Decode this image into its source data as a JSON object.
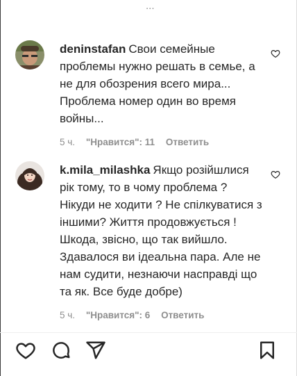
{
  "top_fragment": "...",
  "comments": [
    {
      "username": "deninstafan",
      "text": "Свои семейные проблемы нужно решать в семье, а не для обозрения всего мира... Проблема номер один во время войны...",
      "time": "5 ч.",
      "likes": "\"Нравится\": 11",
      "reply_label": "Ответить"
    },
    {
      "username": "k.mila_milashka",
      "text": "Якщо розійшлися рік тому, то в чому проблема ? Нікуди не ходити ? Не спілкуватися з іншими? Життя продовжується ! Шкода, звісно, що так вийшло. Здавалося ви ідеальна пара. Але не нам судити, незнаючи насправді що та як. Все буде добре)",
      "time": "5 ч.",
      "likes": "\"Нравится\": 6",
      "reply_label": "Ответить"
    }
  ],
  "icons": {
    "like": "heart-icon",
    "comment": "comment-icon",
    "share": "share-icon",
    "save": "bookmark-icon"
  }
}
